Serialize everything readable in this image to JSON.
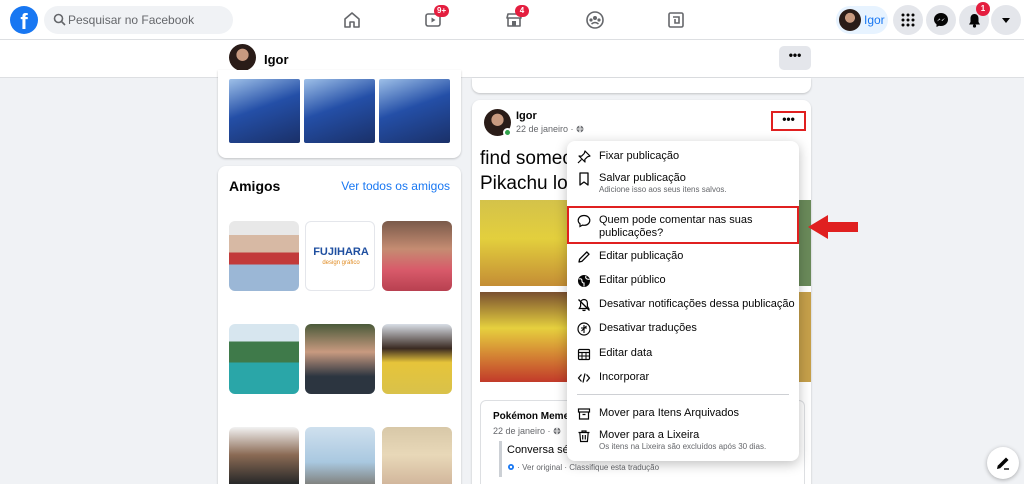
{
  "topbar": {
    "logo": "f",
    "search_placeholder": "Pesquisar no Facebook",
    "watch_badge": "9+",
    "marketplace_badge": "4",
    "profile_name": "Igor",
    "notifications_badge": "1",
    "brand_color": "#1877f2",
    "badge_color": "#e41e3f"
  },
  "profile_bar": {
    "name": "Igor",
    "more_label": "•••"
  },
  "friends": {
    "title": "Amigos",
    "see_all": "Ver todos os amigos",
    "tile_logo_text": "FUJIHARA",
    "tile_logo_sub": "design gráfico"
  },
  "post": {
    "author": "Igor",
    "date": "22 de janeiro · ",
    "more_label": "•••",
    "text_line1": "find someo",
    "text_line2": "Pikachu lov",
    "shared": {
      "page_name": "Pokémon Meme",
      "date": "22 de janeiro · ",
      "text": "Conversa séri",
      "translation": "· Ver original · Classifique esta tradução"
    }
  },
  "menu": {
    "items": [
      {
        "icon": "pin-icon",
        "label": "Fixar publicação",
        "sub": ""
      },
      {
        "icon": "bookmark-icon",
        "label": "Salvar publicação",
        "sub": "Adicione isso aos seus itens salvos."
      },
      {
        "icon": "comment-icon",
        "label": "Quem pode comentar nas suas publicações?",
        "sub": ""
      },
      {
        "icon": "pencil-icon",
        "label": "Editar publicação",
        "sub": ""
      },
      {
        "icon": "globe-icon",
        "label": "Editar público",
        "sub": ""
      },
      {
        "icon": "bell-off-icon",
        "label": "Desativar notificações dessa publicação",
        "sub": ""
      },
      {
        "icon": "translate-icon",
        "label": "Desativar traduções",
        "sub": ""
      },
      {
        "icon": "calendar-icon",
        "label": "Editar data",
        "sub": ""
      },
      {
        "icon": "code-icon",
        "label": "Incorporar",
        "sub": ""
      },
      {
        "icon": "archive-icon",
        "label": "Mover para Itens Arquivados",
        "sub": ""
      },
      {
        "icon": "trash-icon",
        "label": "Mover para a Lixeira",
        "sub": "Os itens na Lixeira são excluídos após 30 dias."
      }
    ],
    "highlight_color": "#e02020"
  }
}
